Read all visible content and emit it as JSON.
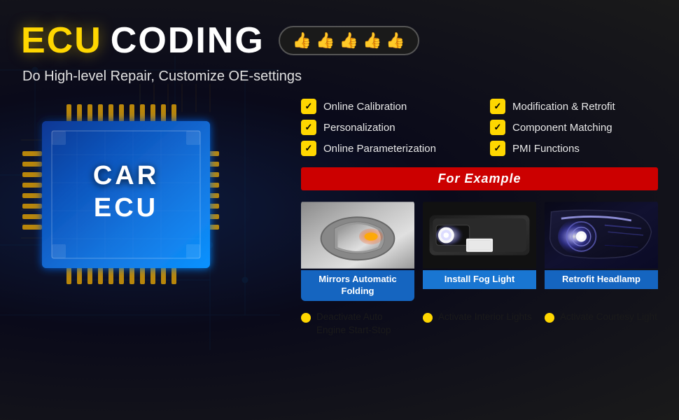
{
  "header": {
    "title_ecu": "ECU",
    "title_coding": "CODING",
    "thumbs": [
      "👍",
      "👍",
      "👍",
      "👍",
      "👍"
    ],
    "subtitle": "Do High-level Repair, Customize OE-settings"
  },
  "features": [
    {
      "label": "Online Calibration"
    },
    {
      "label": "Personalization"
    },
    {
      "label": "Online Parameterization"
    },
    {
      "label": "Modification & Retrofit"
    },
    {
      "label": "Component Matching"
    },
    {
      "label": "PMI Functions"
    }
  ],
  "for_example": "For Example",
  "cards": [
    {
      "type": "mirror",
      "label": "Mirrors Automatic Folding",
      "label_style": "label-blue"
    },
    {
      "type": "fog",
      "label": "Install Fog Light",
      "label_style": "label-bright-blue"
    },
    {
      "type": "headlamp",
      "label": "Retrofit Headlamp",
      "label_style": "label-blue2"
    }
  ],
  "bottom_items": [
    {
      "text": "Deactivate Auto Engine Start-Stop"
    },
    {
      "text": "Activate Interior Lights"
    },
    {
      "text": "Activate Courtesy Light"
    }
  ],
  "chip": {
    "line1": "CAR",
    "line2": "ECU"
  }
}
